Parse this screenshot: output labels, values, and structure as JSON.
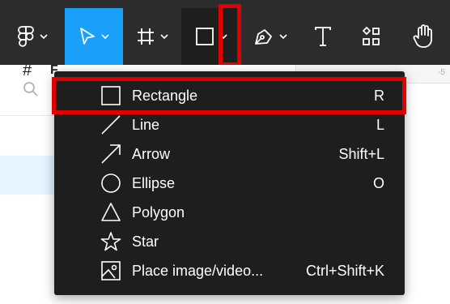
{
  "toolbar": {
    "tools": [
      {
        "name": "main-menu",
        "icon": "figma-logo-icon",
        "has_chevron": true
      },
      {
        "name": "move",
        "icon": "cursor-arrow-icon",
        "has_chevron": true,
        "active": true
      },
      {
        "name": "frame",
        "icon": "frame-hash-icon",
        "has_chevron": true
      },
      {
        "name": "shape",
        "icon": "rectangle-icon",
        "has_chevron": true,
        "pressed": true
      },
      {
        "name": "pen",
        "icon": "pen-nib-icon",
        "has_chevron": true
      },
      {
        "name": "text",
        "icon": "text-t-icon",
        "label": "T"
      },
      {
        "name": "resources",
        "icon": "resources-grid-icon"
      },
      {
        "name": "hand",
        "icon": "hand-icon"
      }
    ],
    "active_color": "#18a0fb",
    "background": "#2c2c2c"
  },
  "highlight_color": "#e10000",
  "ruler": {
    "ticks": [
      "-5"
    ]
  },
  "left_panel": {
    "page_initial": "F"
  },
  "shape_menu": {
    "items": [
      {
        "label": "Rectangle",
        "shortcut": "R",
        "icon": "rectangle-icon",
        "highlighted": true
      },
      {
        "label": "Line",
        "shortcut": "L",
        "icon": "line-icon"
      },
      {
        "label": "Arrow",
        "shortcut": "Shift+L",
        "icon": "arrow-icon"
      },
      {
        "label": "Ellipse",
        "shortcut": "O",
        "icon": "ellipse-icon"
      },
      {
        "label": "Polygon",
        "shortcut": "",
        "icon": "polygon-icon"
      },
      {
        "label": "Star",
        "shortcut": "",
        "icon": "star-icon"
      },
      {
        "label": "Place image/video...",
        "shortcut": "Ctrl+Shift+K",
        "icon": "image-icon"
      }
    ]
  }
}
